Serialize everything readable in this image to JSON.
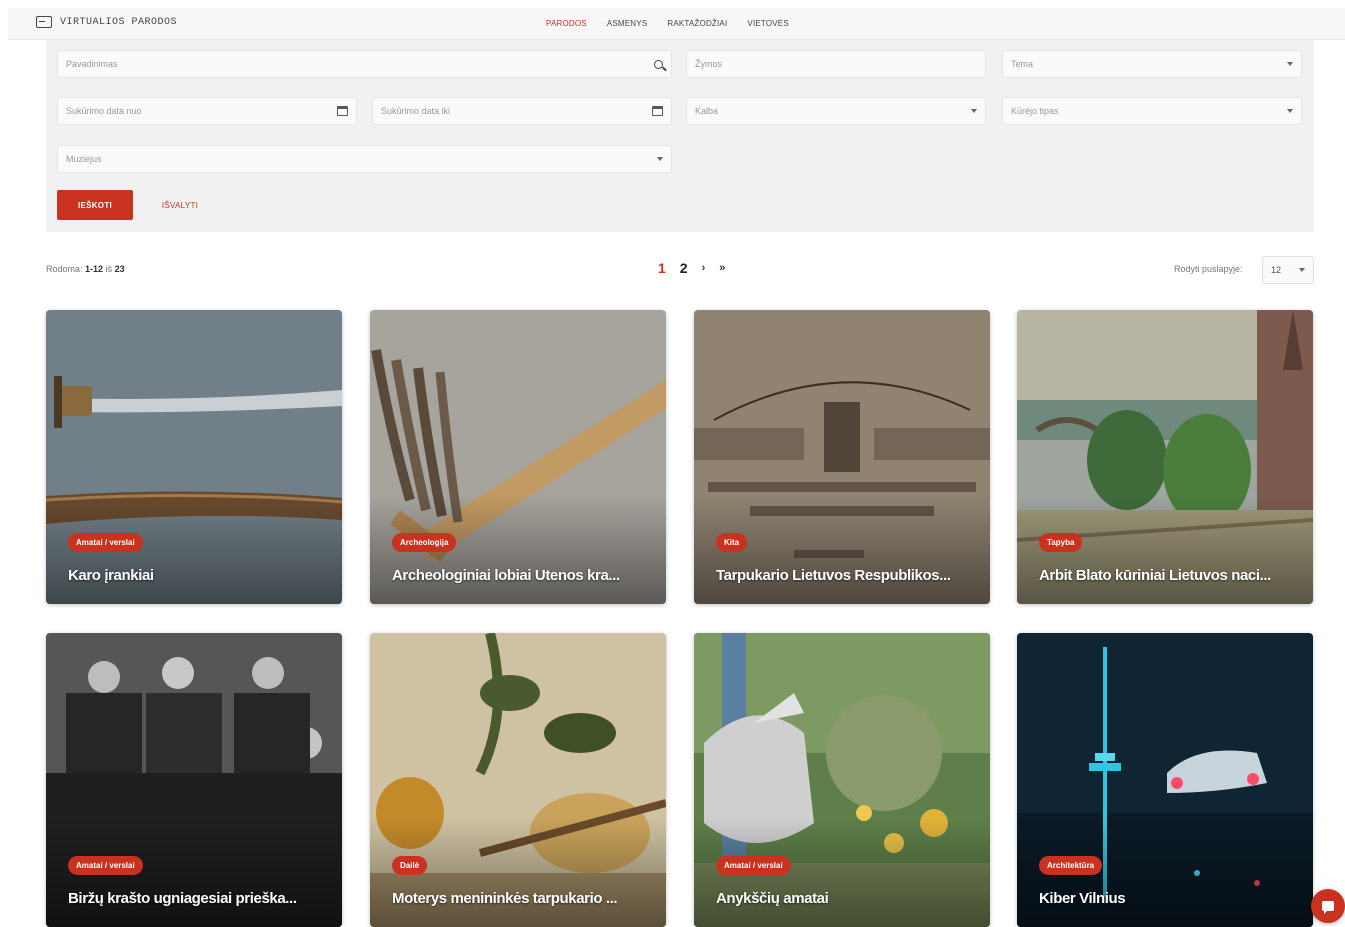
{
  "app": {
    "brand": "VIRTUALIOS PARODOS"
  },
  "nav": {
    "items": [
      "PARODOS",
      "ASMENYS",
      "RAKTAŽODŽIAI",
      "VIETOVĖS"
    ],
    "active": "PARODOS"
  },
  "filters": {
    "title_placeholder": "Pavadinimas",
    "author_placeholder": "Žymos",
    "topic_placeholder": "Tema",
    "date_from_placeholder": "Sukūrimo data nuo",
    "date_to_placeholder": "Sukūrimo data iki",
    "language_placeholder": "Kalba",
    "type_placeholder": "Kūrėjo tipas",
    "museum_placeholder": "Muziejus",
    "search_button": "IEŠKOTI",
    "clear_button": "IŠVALYTI"
  },
  "results": {
    "count_prefix": "Rodoma:",
    "count_range": "1-12",
    "count_of": "iš",
    "count_total": "23",
    "pages": [
      "1",
      "2"
    ],
    "next": "›",
    "last": "»",
    "per_page_label": "Rodyti puslapyje:",
    "per_page_value": "12"
  },
  "cards": [
    {
      "tag": "Amatai / verslai",
      "title": "Karo įrankiai"
    },
    {
      "tag": "Archeologija",
      "title": "Archeologiniai lobiai Utenos kra..."
    },
    {
      "tag": "Kita",
      "title": "Tarpukario Lietuvos Respublikos..."
    },
    {
      "tag": "Tapyba",
      "title": "Arbit Blato kūriniai Lietuvos naci..."
    },
    {
      "tag": "Amatai / verslai",
      "title": "Biržų krašto ugniagesiai prieška..."
    },
    {
      "tag": "Dailė",
      "title": "Moterys menininkės tarpukario ..."
    },
    {
      "tag": "Amatai / verslai",
      "title": "Anykščių amatai"
    },
    {
      "tag": "Architektūra",
      "title": "Kiber Vilnius"
    }
  ],
  "colors": {
    "accent": "#c8321f"
  },
  "icons": {
    "search": "search-icon",
    "calendar": "calendar-icon",
    "chat": "chat-icon"
  }
}
